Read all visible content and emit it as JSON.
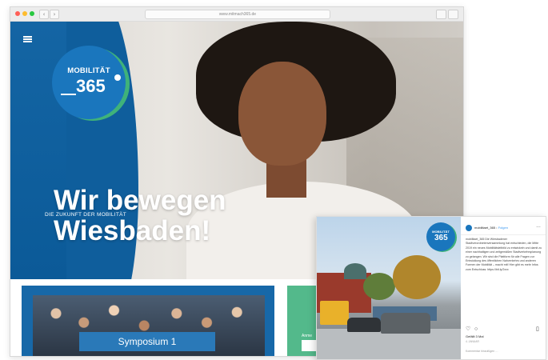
{
  "browser": {
    "url": "www.mitmach365.de",
    "nav": {
      "back": "‹",
      "forward": "›"
    }
  },
  "hero": {
    "logo": {
      "top": "MOBILITÄT",
      "number": "365"
    },
    "headline_line1": "Wir bewegen",
    "headline_line2": "Wiesbaden!",
    "subline": "DIE ZUKUNFT DER MOBILITÄT"
  },
  "below": {
    "card1_label": "Symposium 1",
    "card2_text": "Anme"
  },
  "instagram": {
    "account": "mobilitaet_365",
    "separator": "•",
    "follow": "Folgen",
    "more": "…",
    "logo": {
      "top": "MOBILITÄT",
      "number": "365"
    },
    "caption": "mobilitaet_365 Die Wiesbadener Stadtverordnetenversammlung hat entschieden, die Mitte 2019 ein neues Mobilitätsleitbild zu entwickeln und damit zu einer nachhaltigen und zeitgemäßen Stadtverkehrsplanung zu gelangen. Wir sind die Plattform für alle Fragen zur Entwicklung des öffentlichen Nahverkehrs und anderen Formen der Mobilität – macht mit! Hier gibt es mehr Infos zum Entschluss: https://bit.ly/2xxx",
    "icons": {
      "like": "♡",
      "comment": "○",
      "share": "➤",
      "save": "▯"
    },
    "likes": "Gefällt 3 Mal",
    "date": "4. JANUAR",
    "comment_placeholder": "Kommentar hinzufügen …"
  },
  "colors": {
    "brand_blue": "#1a76bd",
    "brand_green": "#3fb27a",
    "card_green": "#53b98b"
  }
}
